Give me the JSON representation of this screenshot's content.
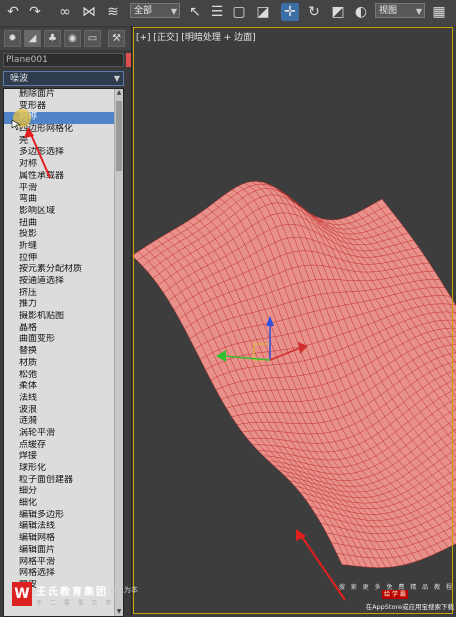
{
  "toolbar": {
    "undo_icon": "undo-icon",
    "redo_icon": "redo-icon",
    "selection_filter": "全部",
    "view_select": "视图"
  },
  "command_panel": {
    "object_name": "Plane001",
    "object_color": "#e05050",
    "modifier_dropdown": "噪波",
    "modifiers": [
      "删除面片",
      "变形器",
      "对称",
      "四边形网格化",
      "壳",
      "多边形选择",
      "对称",
      "属性承载器",
      "平滑",
      "弯曲",
      "影响区域",
      "扭曲",
      "投影",
      "折缝",
      "拉伸",
      "按元素分配材质",
      "按通道选择",
      "挤压",
      "推力",
      "摄影机贴图",
      "晶格",
      "曲面变形",
      "替换",
      "材质",
      "松弛",
      "柔体",
      "法线",
      "波浪",
      "涟漪",
      "涡轮平滑",
      "点缓存",
      "焊接",
      "球形化",
      "粒子面创建器",
      "细分",
      "细化",
      "编辑多边形",
      "编辑法线",
      "编辑网格",
      "编辑面片",
      "网格平滑",
      "网格选择",
      "蒙皮"
    ],
    "selected_index": 2
  },
  "viewport": {
    "label": "[+] [正交] [明暗处理 + 边面]",
    "mesh_color": "#e8908a",
    "wire_color": "#c03030"
  },
  "watermark": {
    "logo_char": "W",
    "brand": "王氏教育集团",
    "tagline": "以人为本",
    "sub": "于 二 零 零 三 年",
    "promo_top": "搜 索 更 多 免 费 精 品 教 程",
    "promo_badge": "绘 学 霸",
    "promo_bottom": "在AppStore或应用宝搜索下载"
  }
}
